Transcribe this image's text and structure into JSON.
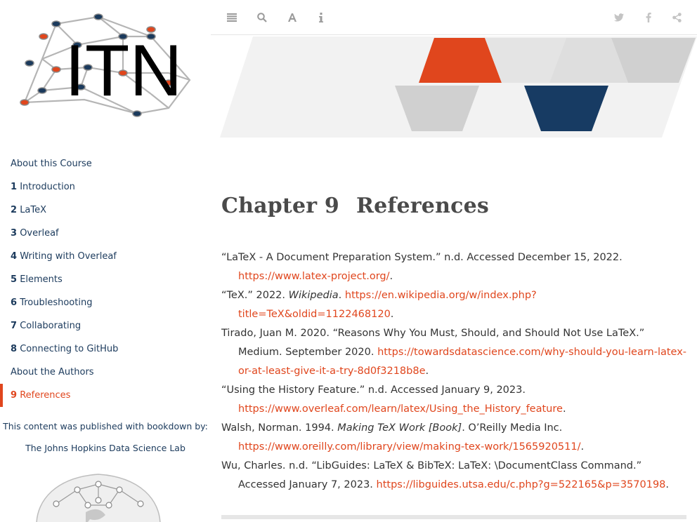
{
  "logo": {
    "text": "ITN"
  },
  "sidebar": {
    "items": [
      {
        "num": "",
        "label": "About this Course"
      },
      {
        "num": "1",
        "label": "Introduction"
      },
      {
        "num": "2",
        "label": "LaTeX"
      },
      {
        "num": "3",
        "label": "Overleaf"
      },
      {
        "num": "4",
        "label": "Writing with Overleaf"
      },
      {
        "num": "5",
        "label": "Elements"
      },
      {
        "num": "6",
        "label": "Troubleshooting"
      },
      {
        "num": "7",
        "label": "Collaborating"
      },
      {
        "num": "8",
        "label": "Connecting to GitHub"
      },
      {
        "num": "",
        "label": "About the Authors"
      },
      {
        "num": "9",
        "label": "References"
      }
    ],
    "published_text": "This content was published with bookdown by:",
    "lab_link": "The Johns Hopkins Data Science Lab"
  },
  "toolbar": {
    "left_icons": [
      "list-icon",
      "search-icon",
      "font-icon",
      "info-icon"
    ],
    "right_icons": [
      "twitter-icon",
      "facebook-icon",
      "share-icon"
    ]
  },
  "colors": {
    "accent": "#e0461d",
    "navy": "#1b3a5c",
    "gray": "#d4d4d4",
    "text": "#333333"
  },
  "chapter": {
    "number": "Chapter 9",
    "title": "References"
  },
  "references": [
    {
      "pre": "“LaTeX - A Document Preparation System.” n.d. Accessed December 15, 2022. ",
      "italic": "",
      "post": "",
      "link": "https://www.latex-project.org/",
      "end": "."
    },
    {
      "pre": "“TeX.” 2022. ",
      "italic": "Wikipedia",
      "post": ". ",
      "link": "https://en.wikipedia.org/w/index.php?title=TeX&oldid=1122468120",
      "end": "."
    },
    {
      "pre": "Tirado, Juan M. 2020. “Reasons Why You Must, Should, and Should Not Use LaTeX.” Medium. September 2020. ",
      "italic": "",
      "post": "",
      "link": "https://towardsdatascience.com/why-should-you-learn-latex-or-at-least-give-it-a-try-8d0f3218b8e",
      "end": "."
    },
    {
      "pre": "“Using the History Feature.” n.d. Accessed January 9, 2023. ",
      "italic": "",
      "post": "",
      "link": "https://www.overleaf.com/learn/latex/Using_the_History_feature",
      "end": "."
    },
    {
      "pre": "Walsh, Norman. 1994. ",
      "italic": "Making TeX Work [Book]",
      "post": ". O’Reilly Media Inc. ",
      "link": "https://www.oreilly.com/library/view/making-tex-work/1565920511/",
      "end": "."
    },
    {
      "pre": "Wu, Charles. n.d. “LibGuides: LaTeX & BibTeX: LaTeX: \\DocumentClass Command.” Accessed January 7, 2023. ",
      "italic": "",
      "post": "",
      "link": "https://libguides.utsa.edu/c.php?g=522165&p=3570198",
      "end": "."
    }
  ]
}
